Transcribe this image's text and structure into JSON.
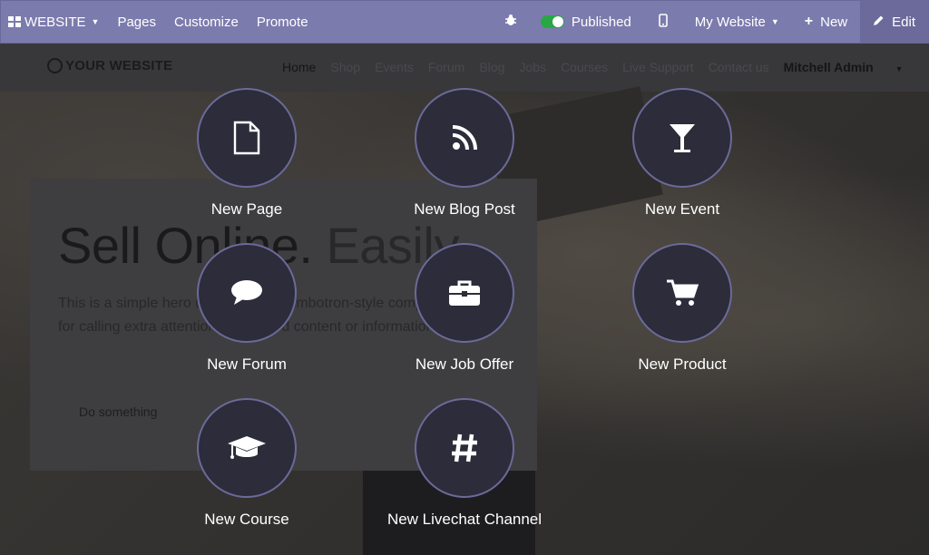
{
  "adminbar": {
    "app_menu": "WEBSITE",
    "pages": "Pages",
    "customize": "Customize",
    "promote": "Promote",
    "published": "Published",
    "my_website": "My Website",
    "new": "New",
    "edit": "Edit"
  },
  "sitebar": {
    "logo": "YOUR WEBSITE",
    "nav": [
      "Home",
      "Shop",
      "Events",
      "Forum",
      "Blog",
      "Jobs",
      "Courses",
      "Live Support",
      "Contact us"
    ],
    "user": "Mitchell Admin"
  },
  "hero": {
    "title_strong": "Sell Online.",
    "title_light": "Easily",
    "text_line1": "This is a simple hero unit, a simple jumbotron-style component",
    "text_line2": "for calling extra attention to featured content or information.",
    "button": "Do something"
  },
  "options": [
    {
      "label": "New Page",
      "icon": "page-icon"
    },
    {
      "label": "New Blog Post",
      "icon": "rss-icon"
    },
    {
      "label": "New Event",
      "icon": "glass-icon"
    },
    {
      "label": "New Forum",
      "icon": "comment-icon"
    },
    {
      "label": "New Job Offer",
      "icon": "briefcase-icon"
    },
    {
      "label": "New Product",
      "icon": "cart-icon"
    },
    {
      "label": "New Course",
      "icon": "graduation-cap-icon"
    },
    {
      "label": "New Livechat Channel",
      "icon": "hashtag-icon"
    }
  ],
  "colors": {
    "adminbar": "#7c7bad",
    "circle_bg": "#2c2c3a",
    "circle_border": "#6b6a9a",
    "published_toggle": "#28a745"
  }
}
